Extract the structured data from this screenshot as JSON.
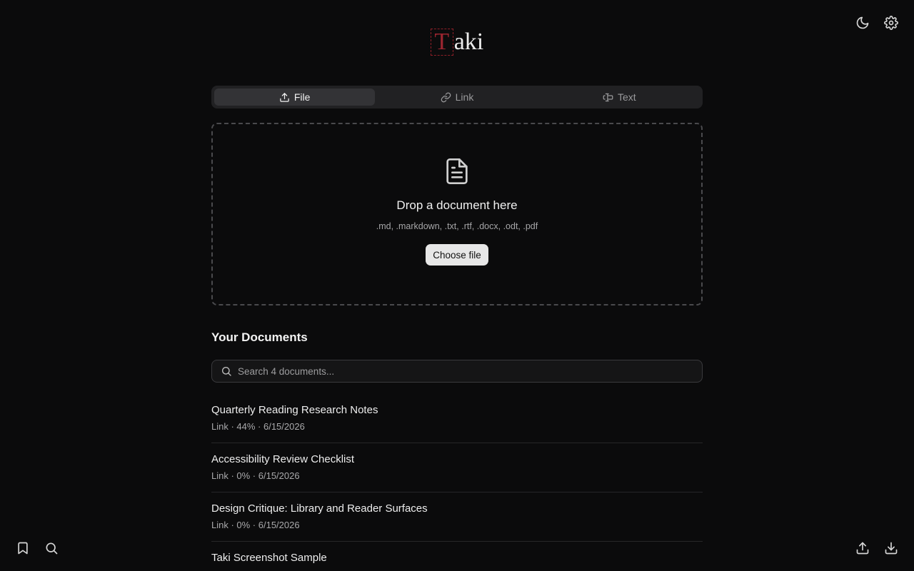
{
  "app": {
    "logo_initial": "T",
    "logo_rest": "aki"
  },
  "top_right": {
    "theme_icon": "moon-icon",
    "settings_icon": "gear-icon"
  },
  "tabs": [
    {
      "label": "File",
      "icon": "upload-icon",
      "active": true
    },
    {
      "label": "Link",
      "icon": "link-icon",
      "active": false
    },
    {
      "label": "Text",
      "icon": "text-cursor-icon",
      "active": false
    }
  ],
  "dropzone": {
    "icon": "file-text-icon",
    "title": "Drop a document here",
    "formats": ".md, .markdown, .txt, .rtf, .docx, .odt, .pdf",
    "button_label": "Choose file"
  },
  "documents": {
    "heading": "Your Documents",
    "search_placeholder": "Search 4 documents...",
    "items": [
      {
        "title": "Quarterly Reading Research Notes",
        "meta": "Link · 44% · 6/15/2026"
      },
      {
        "title": "Accessibility Review Checklist",
        "meta": "Link · 0% · 6/15/2026"
      },
      {
        "title": "Design Critique: Library and Reader Surfaces",
        "meta": "Link · 0% · 6/15/2026"
      },
      {
        "title": "Taki Screenshot Sample",
        "meta": ""
      }
    ]
  },
  "bottom_left": {
    "bookmark_icon": "bookmark-icon",
    "search_icon": "search-icon"
  },
  "bottom_right": {
    "export_icon": "upload-icon",
    "import_icon": "download-icon"
  },
  "colors": {
    "background": "#0b0b0c",
    "logo_accent": "#9b2530",
    "button_bg": "#e7e7e7"
  }
}
